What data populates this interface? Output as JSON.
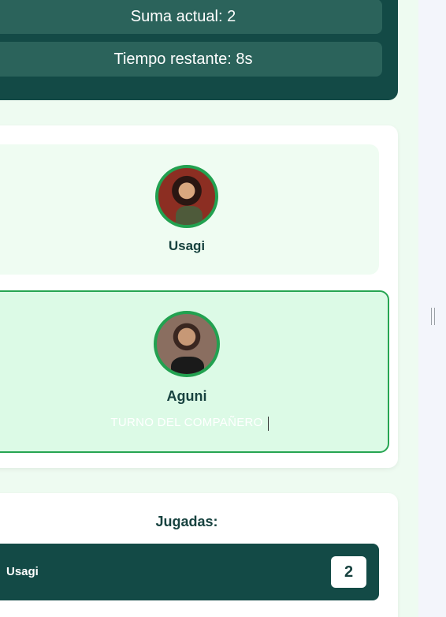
{
  "stats": {
    "current_sum": "Suma actual: 2",
    "time_left": "Tiempo restante: 8s"
  },
  "players": [
    {
      "name": "Usagi",
      "active": false
    },
    {
      "name": "Aguni",
      "active": true,
      "status": "TURNO DEL COMPAÑERO"
    }
  ],
  "plays": {
    "title": "Jugadas:",
    "rows": [
      {
        "player": "Usagi",
        "count": "2"
      }
    ]
  },
  "colors": {
    "dark_teal": "#134a46",
    "pill": "#2b635b",
    "accent_green": "#22a150",
    "active_bg": "#dcfae6"
  }
}
